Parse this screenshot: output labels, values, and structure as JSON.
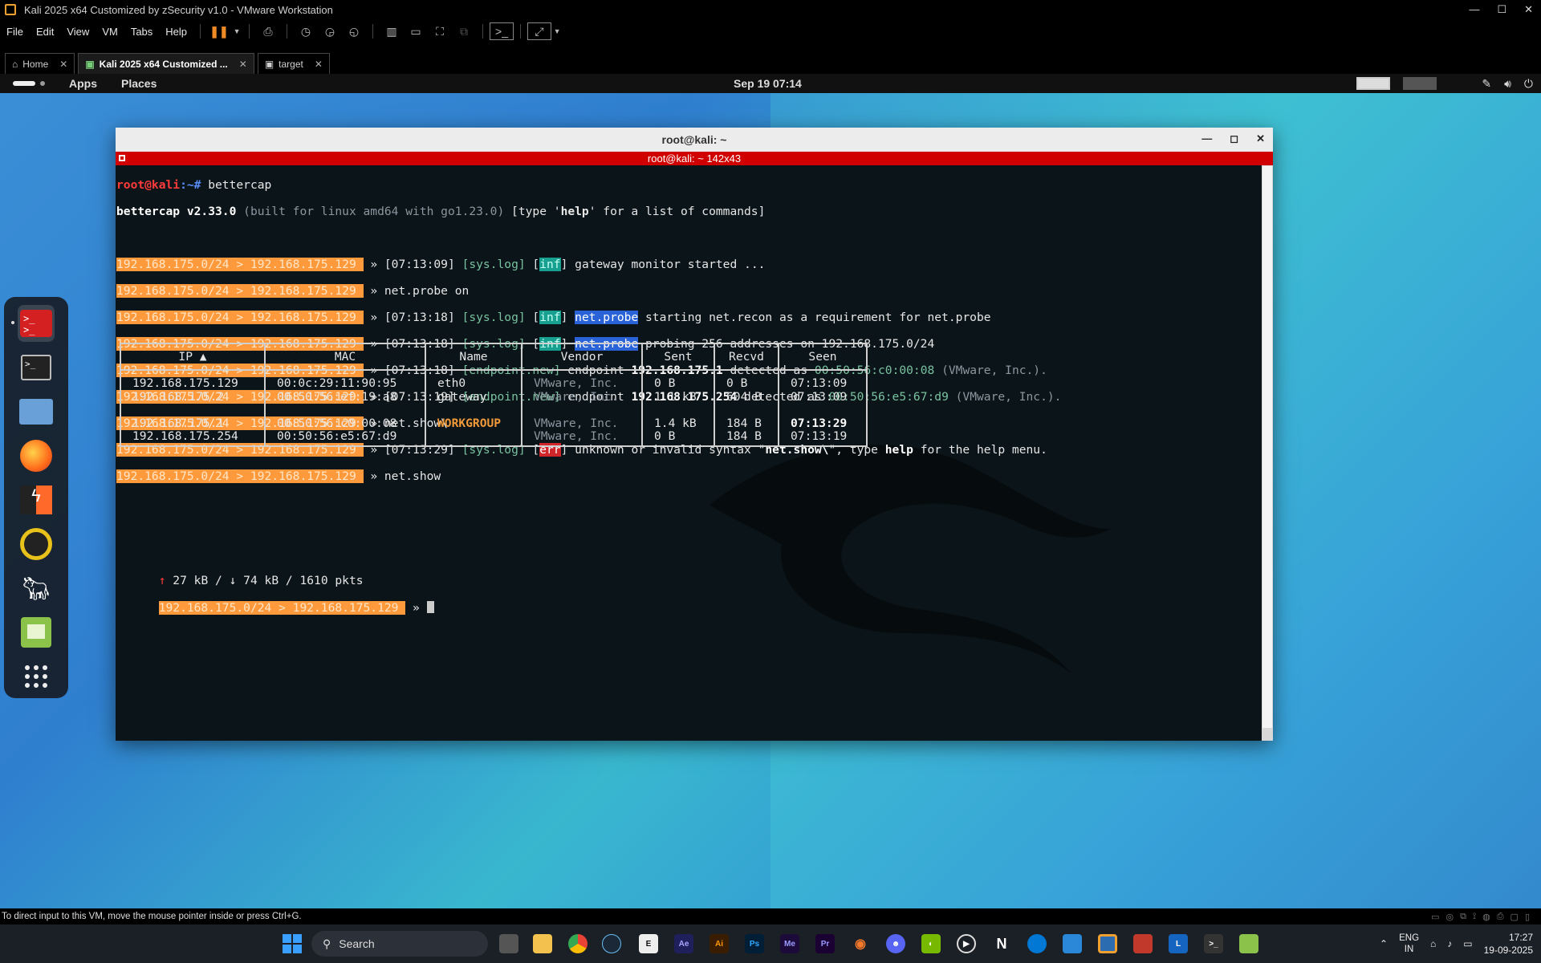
{
  "vmware": {
    "title": "Kali 2025 x64 Customized by zSecurity v1.0 - VMware Workstation",
    "menus": [
      "File",
      "Edit",
      "View",
      "VM",
      "Tabs",
      "Help"
    ],
    "tabs": [
      {
        "label": "Home"
      },
      {
        "label": "Kali 2025 x64 Customized ..."
      },
      {
        "label": "target"
      }
    ],
    "status_text": "To direct input to this VM, move the mouse pointer inside or press Ctrl+G."
  },
  "gnome": {
    "apps": "Apps",
    "places": "Places",
    "clock": "Sep 19  07:14"
  },
  "terminal": {
    "title": "root@kali: ~",
    "subtitle": "root@kali: ~ 142x43",
    "prompt_user": "root@kali",
    "prompt_path": ":~# ",
    "command": "bettercap",
    "version_line_a": "bettercap v2.33.0",
    "version_line_b": " (built for linux amd64 with go1.23.0) ",
    "version_line_c": "[type '",
    "version_line_help": "help",
    "version_line_d": "' for a list of commands]",
    "bc_prompt": "192.168.175.0/24 > 192.168.175.129 ",
    "arrow": " » ",
    "log": {
      "l1_time": "[07:13:09]",
      "l1_tag": "[sys.log]",
      "l1_text": " gateway monitor started ...",
      "l2_cmd": "net.probe on",
      "l3_time": "[07:13:18]",
      "l3_tag": "[sys.log]",
      "l3_mod": "net.probe",
      "l3_text": " starting net.recon as a requirement for net.probe",
      "l4_time": "[07:13:18]",
      "l4_tag": "[sys.log]",
      "l4_mod": "net.probe",
      "l4_text": " probing 256 addresses on 192.168.175.0/24",
      "l5_time": "[07:13:18]",
      "l5_tag": "[endpoint.new]",
      "l5_a": " endpoint ",
      "l5_ip": "192.168.175.1",
      "l5_b": " detected as ",
      "l5_mac": "00:50:56:c0:00:08",
      "l5_vendor": " (VMware, Inc.).",
      "l6_time": "[07:13:19]",
      "l6_tag": "[endpoint.new]",
      "l6_a": " endpoint ",
      "l6_ip": "192.168.175.254",
      "l6_b": " detected as ",
      "l6_mac": "00:50:56:e5:67:d9",
      "l6_vendor": " (VMware, Inc.).",
      "l7_cmd": "net.show\\",
      "l8_time": "[07:13:29]",
      "l8_tag": "[sys.log]",
      "l8_a": " unknown or invalid syntax \"",
      "l8_cmd": "net.show\\",
      "l8_b": "\", type ",
      "l8_help": "help",
      "l8_c": " for the help menu.",
      "l9_cmd": "net.show",
      "inf": "inf",
      "err": "err"
    },
    "table": {
      "headers": [
        "IP ▲",
        "MAC",
        "Name",
        "Vendor",
        "Sent",
        "Recvd",
        "Seen"
      ],
      "group1": {
        "ip": [
          "192.168.175.129",
          "192.168.175.2"
        ],
        "mac": [
          "00:0c:29:11:90:95",
          "00:50:56:ef:19:a8"
        ],
        "name": [
          "eth0",
          "gateway"
        ],
        "vendor": [
          "VMware, Inc.",
          "VMware, Inc."
        ],
        "sent": [
          "0 B",
          "1.1 kB"
        ],
        "recvd": [
          "0 B",
          "604 B"
        ],
        "seen": [
          "07:13:09",
          "07:13:09"
        ]
      },
      "group2": {
        "ip": [
          "192.168.175.1",
          "192.168.175.254"
        ],
        "mac": [
          "00:50:56:c0:00:08",
          "00:50:56:e5:67:d9"
        ],
        "name": [
          "WORKGROUP",
          ""
        ],
        "vendor": [
          "VMware, Inc.",
          "VMware, Inc."
        ],
        "sent": [
          "1.4 kB",
          "0 B"
        ],
        "recvd": [
          "184 B",
          "184 B"
        ],
        "seen": [
          "07:13:29",
          "07:13:19"
        ]
      }
    },
    "traffic_up": "↑",
    "traffic_text_a": " 27 kB / ",
    "traffic_down": "↓",
    "traffic_text_b": " 74 kB / 1610 pkts"
  },
  "taskbar": {
    "search": "Search",
    "lang_top": "ENG",
    "lang_bottom": "IN",
    "time": "17:27",
    "date": "19-09-2025"
  },
  "colors": {
    "prompt_bg": "#ff9a3c",
    "terminal_bg": "#0b1418",
    "title_red": "#d00000"
  }
}
